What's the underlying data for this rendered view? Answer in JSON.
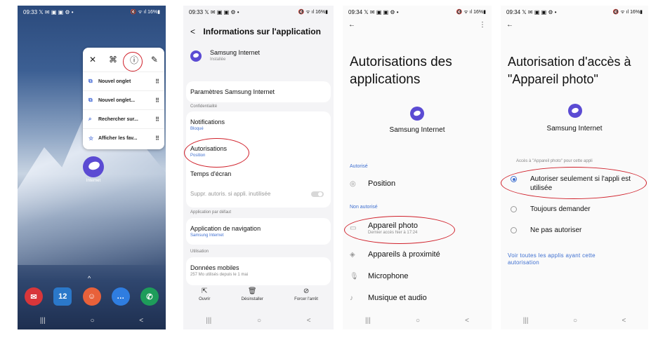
{
  "status": {
    "p1_time": "09:33 𝕏 ✉ ▣ ▣ ⚙ •",
    "p2_time": "09:33 𝕏 ✉ ▣ ▣ ⚙ •",
    "p3_time": "09:34 𝕏 ✉ ▣ ▣ ⚙ •",
    "p4_time": "09:34 𝕏 ✉ ▣ ▣ ⚙ •",
    "right": "🔇 ᯤ ıl 16%▮"
  },
  "nav": {
    "recents": "|||",
    "home": "○",
    "back": "<"
  },
  "home": {
    "menu_icons": {
      "close": "✕",
      "grid": "⌘",
      "info": "ⓘ",
      "edit": "✎"
    },
    "menu_items": [
      {
        "icon": "⧉",
        "label": "Nouvel onglet",
        "handle": "⠿"
      },
      {
        "icon": "⧉",
        "label": "Nouvel onglet...",
        "handle": "⠿"
      },
      {
        "icon": "⌕",
        "label": "Rechercher sur...",
        "handle": "⠿"
      },
      {
        "icon": "☆",
        "label": "Afficher les fav...",
        "handle": "⠿"
      }
    ],
    "app_label": "Internet",
    "swipe_up": "^",
    "dock": [
      {
        "glyph": "✉",
        "color": "#d8363a"
      },
      {
        "glyph": "12",
        "color": "#2b78c9"
      },
      {
        "glyph": "☺",
        "color": "#e8613a"
      },
      {
        "glyph": "…",
        "color": "#2f7de0"
      },
      {
        "glyph": "✆",
        "color": "#1e9c5a"
      }
    ]
  },
  "appinfo": {
    "back": "<",
    "title": "Informations sur l'application",
    "app_name": "Samsung Internet",
    "app_status": "Installée",
    "settings_row": "Paramètres Samsung Internet",
    "sec_privacy": "Confidentialité",
    "notifications": "Notifications",
    "notifications_sub": "Bloqué",
    "autorisations": "Autorisations",
    "autorisations_sub": "Position",
    "screen_time": "Temps d'écran",
    "suppr": "Suppr. autoris. si appli. inutilisée",
    "sec_default": "Application par défaut",
    "nav_app": "Application de navigation",
    "nav_app_sub": "Samsung Internet",
    "sec_usage": "Utilisation",
    "mobile_data": "Données mobiles",
    "mobile_data_sub": "257 Mo utilisés depuis le 1 mai",
    "btn_open": "Ouvrir",
    "btn_uninstall": "Désinstaller",
    "btn_force": "Forcer l'arrêt",
    "icon_open": "⇱",
    "icon_uninstall": "🗑",
    "icon_force": "⊘"
  },
  "perms": {
    "back": "←",
    "more": "⋮",
    "title_l1": "Autorisations des",
    "title_l2": "applications",
    "app_name": "Samsung Internet",
    "sec_allowed": "Autorisé",
    "position": "Position",
    "sec_denied": "Non autorisé",
    "camera": "Appareil photo",
    "camera_sub": "Dernier accès hier à 17:24",
    "nearby": "Appareils à proximité",
    "microphone": "Microphone",
    "music": "Musique et audio",
    "icons": {
      "position": "◎",
      "camera": "▭",
      "nearby": "◈",
      "microphone": "🎙",
      "music": "♪"
    }
  },
  "camera_perm": {
    "back": "←",
    "title_l1": "Autorisation d'accès à",
    "title_l2": "\"Appareil photo\"",
    "app_name": "Samsung Internet",
    "note": "Accès à \"Appareil photo\" pour cette appli",
    "opt1_l1": "Autoriser seulement si l'appli est",
    "opt1_l2": "utilisée",
    "opt2": "Toujours demander",
    "opt3": "Ne pas autoriser",
    "link_l1": "Voir toutes les applis ayant cette",
    "link_l2": "autorisation"
  }
}
